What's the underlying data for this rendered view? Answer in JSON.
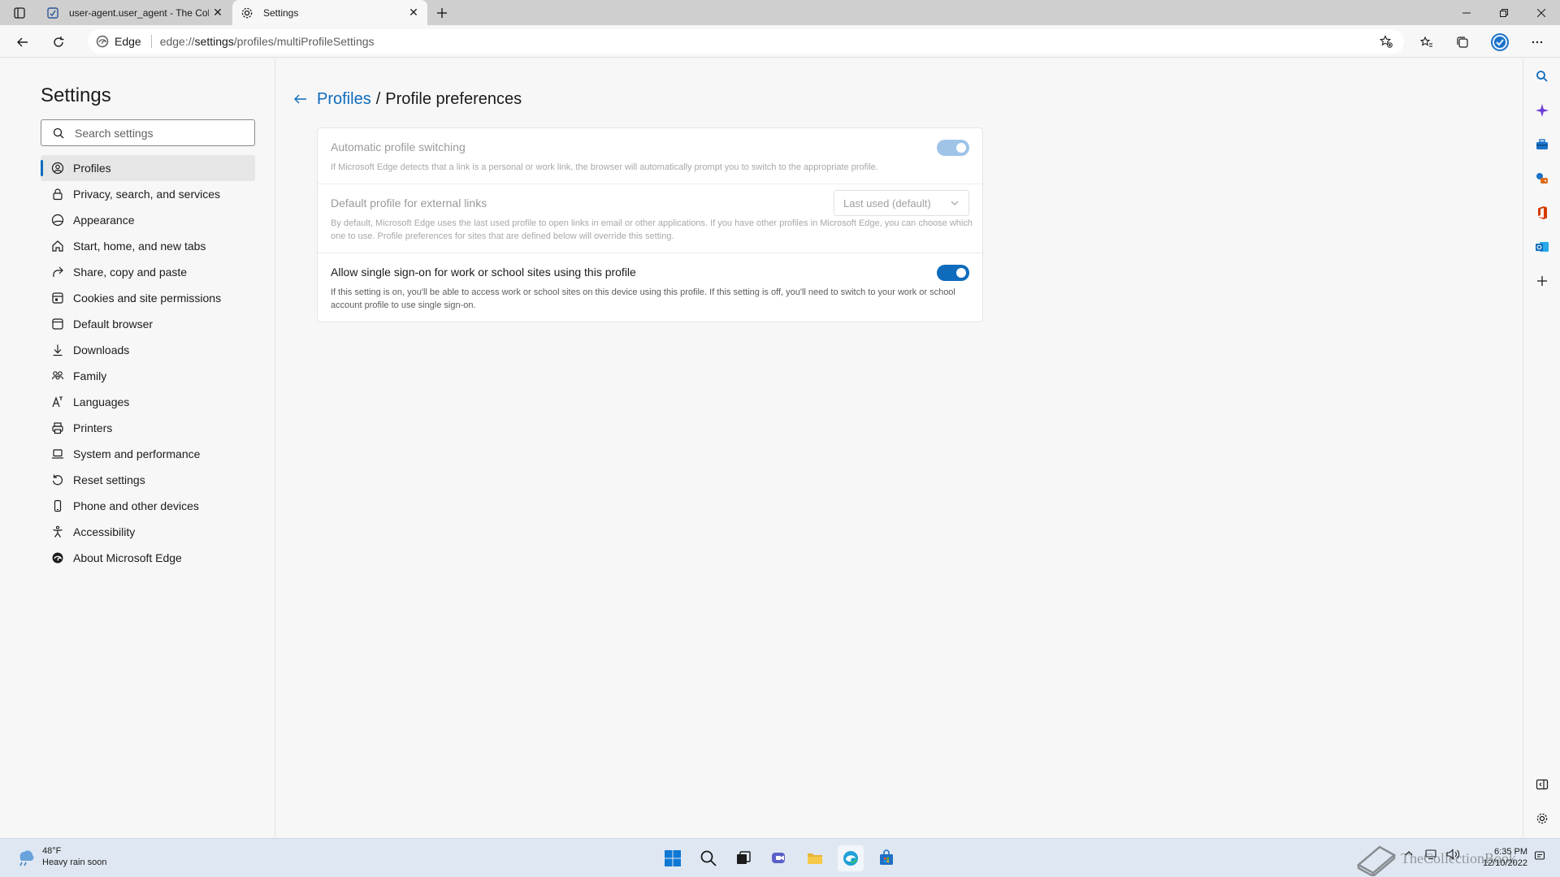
{
  "browser": {
    "tabs": [
      {
        "title": "user-agent.user_agent - The Coll",
        "active": false
      },
      {
        "title": "Settings",
        "active": true
      }
    ],
    "address": {
      "site": "Edge",
      "url_prefix": "edge://",
      "url_host": "settings",
      "url_path": "/profiles/multiProfileSettings"
    }
  },
  "settings": {
    "title": "Settings",
    "search_placeholder": "Search settings",
    "nav": [
      {
        "label": "Profiles",
        "icon": "profile-icon",
        "selected": true
      },
      {
        "label": "Privacy, search, and services",
        "icon": "lock-icon"
      },
      {
        "label": "Appearance",
        "icon": "appearance-icon"
      },
      {
        "label": "Start, home, and new tabs",
        "icon": "home-icon"
      },
      {
        "label": "Share, copy and paste",
        "icon": "share-icon"
      },
      {
        "label": "Cookies and site permissions",
        "icon": "cookies-icon"
      },
      {
        "label": "Default browser",
        "icon": "browser-icon"
      },
      {
        "label": "Downloads",
        "icon": "download-icon"
      },
      {
        "label": "Family",
        "icon": "family-icon"
      },
      {
        "label": "Languages",
        "icon": "language-icon"
      },
      {
        "label": "Printers",
        "icon": "printer-icon"
      },
      {
        "label": "System and performance",
        "icon": "laptop-icon"
      },
      {
        "label": "Reset settings",
        "icon": "reset-icon"
      },
      {
        "label": "Phone and other devices",
        "icon": "phone-icon"
      },
      {
        "label": "Accessibility",
        "icon": "accessibility-icon"
      },
      {
        "label": "About Microsoft Edge",
        "icon": "edge-icon"
      }
    ]
  },
  "page": {
    "breadcrumb_parent": "Profiles",
    "breadcrumb_separator": "/",
    "breadcrumb_current": "Profile preferences",
    "rows": [
      {
        "title": "Automatic profile switching",
        "description": "If Microsoft Edge detects that a link is a personal or work link, the browser will automatically prompt you to switch to the appropriate profile.",
        "enabled": false,
        "toggle_on": true
      },
      {
        "title": "Default profile for external links",
        "description": "By default, Microsoft Edge uses the last used profile to open links in email or other applications. If you have other profiles in Microsoft Edge, you can choose which one to use. Profile preferences for sites that are defined below will override this setting.",
        "enabled": false,
        "dropdown_value": "Last used (default)"
      },
      {
        "title": "Allow single sign-on for work or school sites using this profile",
        "description": "If this setting is on, you'll be able to access work or school sites on this device using this profile. If this setting is off, you'll need to switch to your work or school account profile to use single sign-on.",
        "enabled": true,
        "toggle_on": true
      }
    ]
  },
  "taskbar": {
    "weather_temp": "48°F",
    "weather_desc": "Heavy rain soon",
    "watermark": "TheCollectionBook",
    "time": "6:35 PM",
    "date": "12/10/2022"
  },
  "colors": {
    "accent": "#0f6cbd",
    "accent_disabled": "#9fc4e8"
  }
}
